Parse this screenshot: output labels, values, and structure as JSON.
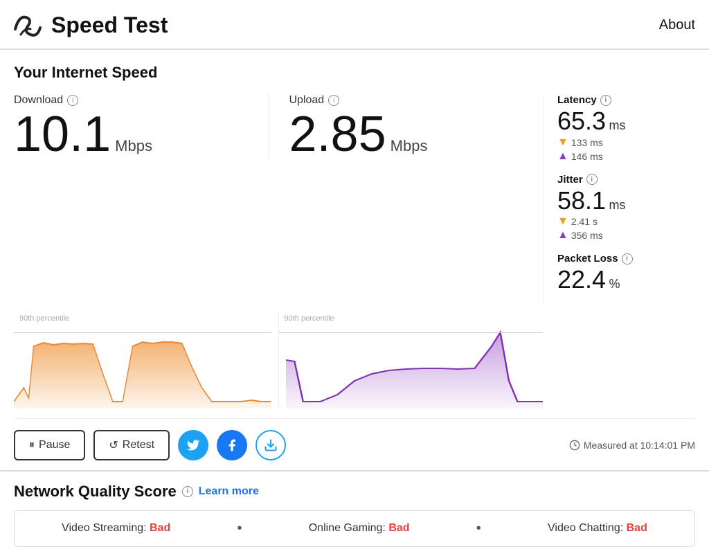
{
  "header": {
    "title": "Speed Test",
    "about_label": "About"
  },
  "internet_speed": {
    "section_title": "Your Internet Speed",
    "download": {
      "label": "Download",
      "value": "10.1",
      "unit": "Mbps",
      "chart_label": "90th percentile"
    },
    "upload": {
      "label": "Upload",
      "value": "2.85",
      "unit": "Mbps",
      "chart_label": "90th percentile"
    },
    "latency": {
      "label": "Latency",
      "value": "65.3",
      "unit": "ms",
      "down_value": "133 ms",
      "up_value": "146 ms"
    },
    "jitter": {
      "label": "Jitter",
      "value": "58.1",
      "unit": "ms",
      "down_value": "2.41 s",
      "up_value": "356 ms"
    },
    "packet_loss": {
      "label": "Packet Loss",
      "value": "22.4",
      "unit": "%"
    }
  },
  "controls": {
    "pause_label": "Pause",
    "retest_label": "Retest",
    "measured_at": "Measured at 10:14:01 PM"
  },
  "network_quality": {
    "section_title": "Network Quality Score",
    "learn_more": "Learn more",
    "items": [
      {
        "label": "Video Streaming:",
        "value": "Bad"
      },
      {
        "label": "Online Gaming:",
        "value": "Bad"
      },
      {
        "label": "Video Chatting:",
        "value": "Bad"
      }
    ]
  }
}
